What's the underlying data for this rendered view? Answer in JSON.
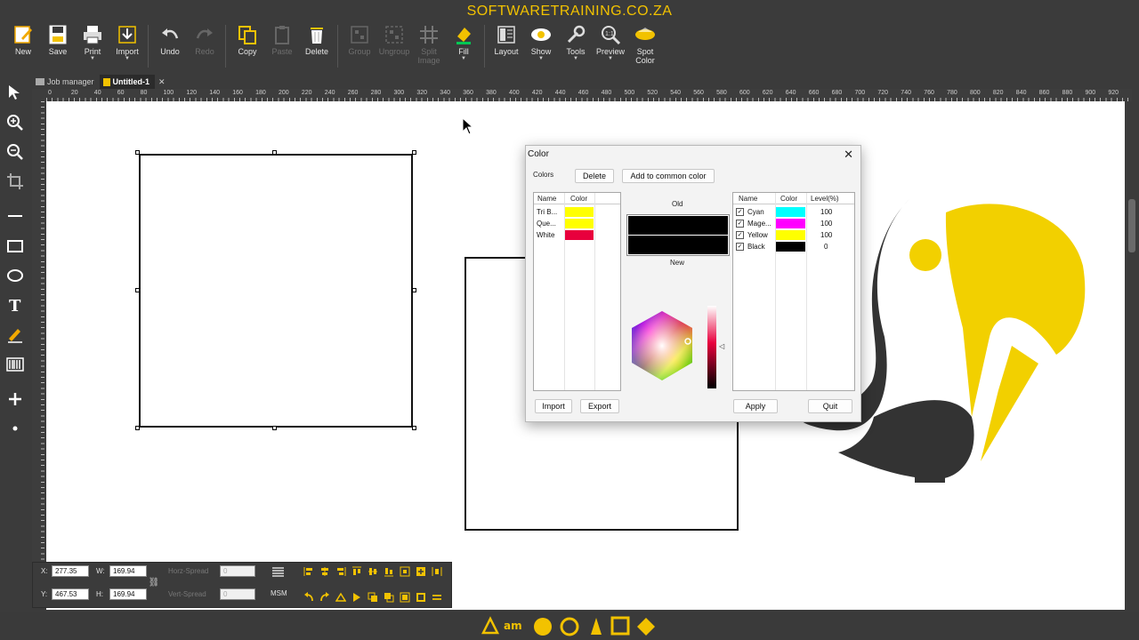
{
  "banner": {
    "text": "SOFTWARETRAINING.CO.ZA"
  },
  "toolbar": {
    "buttons": [
      {
        "label": "New"
      },
      {
        "label": "Save"
      },
      {
        "label": "Print"
      },
      {
        "label": "Import"
      },
      {
        "label": "Undo"
      },
      {
        "label": "Redo"
      },
      {
        "label": "Copy"
      },
      {
        "label": "Paste"
      },
      {
        "label": "Delete"
      },
      {
        "label": "Group"
      },
      {
        "label": "Ungroup"
      },
      {
        "label": "Split Image"
      },
      {
        "label": "Fill"
      },
      {
        "label": "Layout"
      },
      {
        "label": "Show"
      },
      {
        "label": "Tools"
      },
      {
        "label": "Preview"
      },
      {
        "label": "Spot Color"
      }
    ]
  },
  "tabs": [
    {
      "label": "Job manager"
    },
    {
      "label": "Untitled-1"
    }
  ],
  "ruler": {
    "h_labels": [
      "0",
      "20",
      "40",
      "60",
      "80",
      "100",
      "120",
      "140",
      "160",
      "180",
      "200",
      "220",
      "240",
      "260",
      "280",
      "300",
      "320",
      "340",
      "360",
      "380",
      "400",
      "420",
      "440",
      "460",
      "480",
      "500",
      "520",
      "540",
      "560",
      "580",
      "600",
      "620",
      "640",
      "660",
      "680",
      "700",
      "720",
      "740",
      "760",
      "780",
      "800",
      "820",
      "840",
      "860",
      "880",
      "900",
      "920"
    ]
  },
  "propbar": {
    "x_label": "X:",
    "x_value": "277.35",
    "y_label": "Y:",
    "y_value": "467.53",
    "w_label": "W:",
    "w_value": "169.94",
    "h_label": "H:",
    "h_value": "169.94",
    "horz_spread_label": "Horz-Spread",
    "horz_spread_value": "0",
    "vert_spread_label": "Vert-Spread",
    "vert_spread_value": "0",
    "msm_label": "MSM"
  },
  "dialog": {
    "title": "Color",
    "colors_label": "Colors",
    "delete_label": "Delete",
    "add_common_label": "Add to common color",
    "left_table": {
      "headers": [
        "Name",
        "Color"
      ],
      "rows": [
        {
          "name": "Tri B...",
          "color": "#ffff00"
        },
        {
          "name": "Que...",
          "color": "#ffff00"
        },
        {
          "name": "White",
          "color": "#e8003d"
        }
      ]
    },
    "old_label": "Old",
    "new_label": "New",
    "old_color": "#000000",
    "new_color": "#000000",
    "right_table": {
      "headers": [
        "Name",
        "Color",
        "Level(%)"
      ],
      "rows": [
        {
          "name": "Cyan",
          "color": "#00ffff",
          "level": "100"
        },
        {
          "name": "Mage...",
          "color": "#ff00ff",
          "level": "100"
        },
        {
          "name": "Yellow",
          "color": "#ffff00",
          "level": "100"
        },
        {
          "name": "Black",
          "color": "#000000",
          "level": "0"
        }
      ]
    },
    "import_label": "Import",
    "export_label": "Export",
    "apply_label": "Apply",
    "quit_label": "Quit"
  },
  "colors": {
    "accent": "#f2c200",
    "logo_dark": "#333333"
  }
}
